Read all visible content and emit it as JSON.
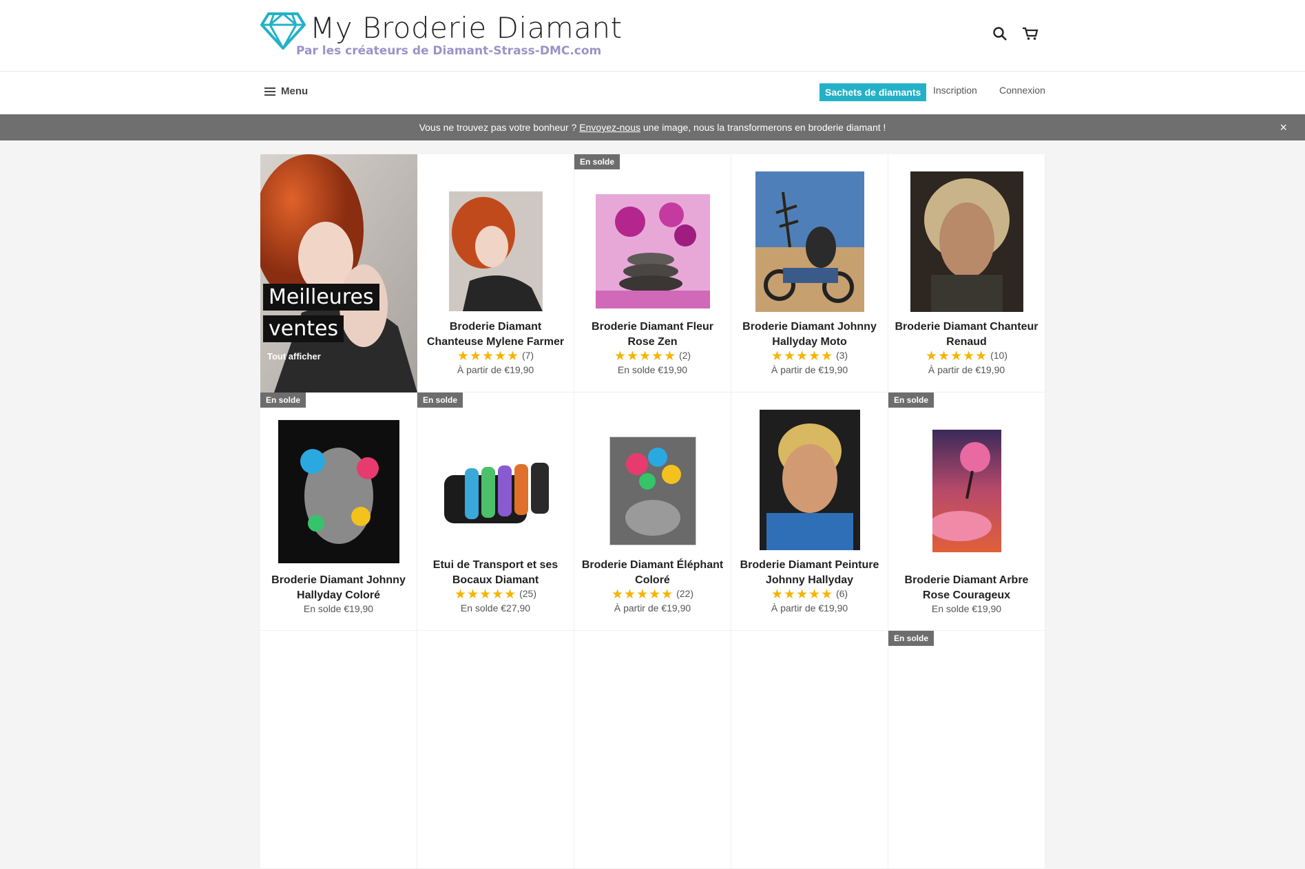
{
  "brand": {
    "title": "My Broderie Diamant",
    "tagline": "Par les créateurs de Diamant-Strass-DMC.com",
    "accent_color": "#24b1c7"
  },
  "header_icons": {
    "search": "search-icon",
    "cart": "cart-icon"
  },
  "nav": {
    "menu_label": "Menu",
    "highlight_link": "Sachets de diamants",
    "signup": "Inscription",
    "login": "Connexion"
  },
  "announcement": {
    "before": "Vous ne trouvez pas votre bonheur ? ",
    "link": "Envoyez-nous",
    "after": " une image, nous la transformerons en broderie diamant !",
    "close": "×"
  },
  "featured": {
    "line1": "Meilleures",
    "line2": "ventes",
    "link": "Tout afficher"
  },
  "products": [
    {
      "name": "Broderie Diamant Chanteuse Mylene Farmer",
      "reviews": "(7)",
      "price": "À partir de €19,90",
      "badge": "",
      "rating": 5
    },
    {
      "name": "Broderie Diamant Fleur Rose Zen",
      "reviews": "(2)",
      "price": "En solde €19,90",
      "badge": "En solde",
      "rating": 5
    },
    {
      "name": "Broderie Diamant Johnny Hallyday Moto",
      "reviews": "(3)",
      "price": "À partir de €19,90",
      "badge": "",
      "rating": 5
    },
    {
      "name": "Broderie Diamant Chanteur Renaud",
      "reviews": "(10)",
      "price": "À partir de €19,90",
      "badge": "",
      "rating": 5
    },
    {
      "name": "Broderie Diamant Johnny Hallyday Coloré",
      "reviews": "",
      "price": "En solde €19,90",
      "badge": "En solde",
      "rating": 0
    },
    {
      "name": "Etui de Transport et ses Bocaux Diamant",
      "reviews": "(25)",
      "price": "En solde €27,90",
      "badge": "En solde",
      "rating": 5
    },
    {
      "name": "Broderie Diamant Éléphant Coloré",
      "reviews": "(22)",
      "price": "À partir de €19,90",
      "badge": "",
      "rating": 5
    },
    {
      "name": "Broderie Diamant Peinture Johnny Hallyday",
      "reviews": "(6)",
      "price": "À partir de €19,90",
      "badge": "",
      "rating": 5
    },
    {
      "name": "Broderie Diamant Arbre Rose Courageux",
      "reviews": "",
      "price": "En solde €19,90",
      "badge": "En solde",
      "rating": 0
    }
  ],
  "row3_badge": "En solde",
  "stars": "★★★★★"
}
